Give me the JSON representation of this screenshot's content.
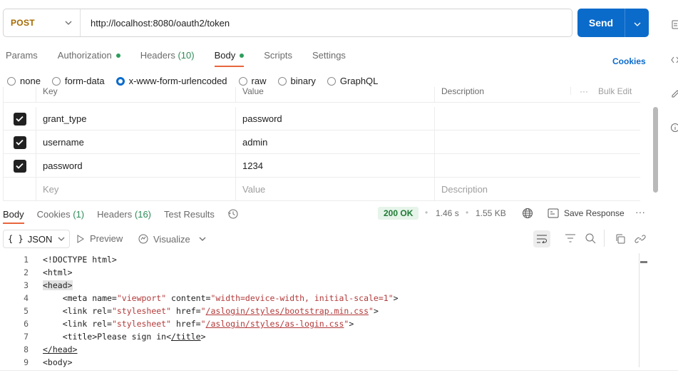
{
  "request": {
    "method": "POST",
    "url": "http://localhost:8080/oauth2/token",
    "send_label": "Send"
  },
  "tabs": [
    {
      "label": "Params"
    },
    {
      "label": "Authorization",
      "dot": true
    },
    {
      "label": "Headers",
      "count": "(10)"
    },
    {
      "label": "Body",
      "dot": true,
      "active": true
    },
    {
      "label": "Scripts"
    },
    {
      "label": "Settings"
    }
  ],
  "cookies_label": "Cookies",
  "body_types": [
    "none",
    "form-data",
    "x-www-form-urlencoded",
    "raw",
    "binary",
    "GraphQL"
  ],
  "body_type_selected": "x-www-form-urlencoded",
  "table": {
    "headers": [
      "Key",
      "Value",
      "Description"
    ],
    "bulk_edit": "Bulk Edit",
    "more": "···",
    "rows": [
      {
        "checked": true,
        "key": "grant_type",
        "value": "password",
        "description": ""
      },
      {
        "checked": true,
        "key": "username",
        "value": "admin",
        "description": ""
      },
      {
        "checked": true,
        "key": "password",
        "value": "1234",
        "description": ""
      }
    ],
    "placeholder": {
      "key": "Key",
      "value": "Value",
      "description": "Description"
    }
  },
  "response": {
    "tabs": [
      {
        "label": "Body",
        "active": true
      },
      {
        "label": "Cookies",
        "count": "(1)"
      },
      {
        "label": "Headers",
        "count": "(16)"
      },
      {
        "label": "Test Results"
      }
    ],
    "status": "200 OK",
    "time": "1.46 s",
    "size": "1.55 KB",
    "save_label": "Save Response",
    "format": "JSON",
    "preview_label": "Preview",
    "visualize_label": "Visualize"
  },
  "code_lines": [
    {
      "n": "1",
      "text": "<!DOCTYPE html>"
    },
    {
      "n": "2",
      "text": "<html>"
    },
    {
      "n": "3",
      "text": "<head>"
    },
    {
      "n": "4",
      "text": "    <meta name=\"viewport\" content=\"width=device-width, initial-scale=1\">"
    },
    {
      "n": "5",
      "text": "    <link rel=\"stylesheet\" href=\"/aslogin/styles/bootstrap.min.css\">"
    },
    {
      "n": "6",
      "text": "    <link rel=\"stylesheet\" href=\"/aslogin/styles/as-login.css\">"
    },
    {
      "n": "7",
      "text": "    <title>Please sign in</title>"
    },
    {
      "n": "8",
      "text": "</head>"
    },
    {
      "n": "9",
      "text": "<body>"
    }
  ],
  "colors": {
    "accent": "#0b6bcb",
    "active_tab": "#e8663d",
    "method": "#a66a00",
    "status_bg": "#e6f4ea",
    "status_fg": "#1e7b34",
    "string": "#b33a3a"
  }
}
